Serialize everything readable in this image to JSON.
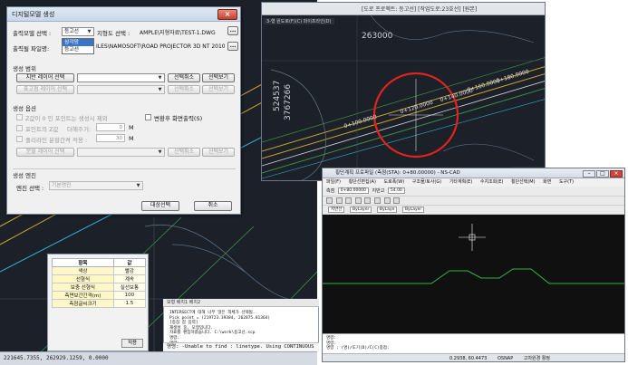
{
  "dialog": {
    "title": "디지털모델 생성",
    "close_label": "×",
    "output_model_label": "출력모델 선택 :",
    "output_model_value": "등고선",
    "output_model_options": [
      "삼각망",
      "등고선"
    ],
    "terrain_select_label": "지형도 선택 :",
    "terrain_path": "AMPLE\\지형자료\\TEST-1.DWG",
    "output_file_label": "출력될 파일명:",
    "output_file_path": "ILES\\NAMOSOFT\\ROAD PROJECTOR 3D NT 2010\\SAMP",
    "browse_label": "...",
    "section_range": "생성 범위",
    "terrain_layer_btn": "지반 레이어 선택",
    "range_cancel_btn": "선택취소",
    "range_view_btn": "선택보기",
    "elev_layer_btn": "표고점 레이어 선택",
    "elev_cancel_btn": "선택취소",
    "elev_view_btn": "선택보기",
    "section_options": "생성 옵션",
    "opt_zero_z": "Z값이 0 인 포인트는 생성시 제외",
    "opt_change_display": "변환후 화면출력(S)",
    "opt_point_z": "포인트의 Z값",
    "opt_increase": "더해주기:",
    "opt_increase_value": "0",
    "opt_increase_unit": "M",
    "opt_split": "폴리라인 분할간격 적용 :",
    "opt_split_value": "30",
    "opt_split_unit": "M",
    "split_layer_btn": "분할 레이어 선택",
    "split_cancel_btn": "선택취소",
    "split_view_btn": "선택보기",
    "section_engine": "생성 엔진",
    "engine_label": "엔진 선택 :",
    "engine_value": "기본엔진",
    "start_btn": "대상선택",
    "cancel_btn": "취소"
  },
  "top_cad": {
    "title": "[도로 프로젝트: 등고선]  [작업도로:23호선]  [원본]",
    "tab": "3-형 원도로(F)(C) 파이프라인(D)",
    "labels": [
      "263000",
      "524537",
      "3767266",
      "0+100.0000",
      "0+120.0000",
      "0+140.0000",
      "0+160.0000",
      "0+180.0000"
    ]
  },
  "profile_win": {
    "title": "횡단계획 프로파일 (측점(STA): 0+80.00000) - NS-CAD",
    "menu": [
      "파일(F)",
      "횡단선편집(A)",
      "도로폭(W)",
      "구조물/토사(G)",
      "기타계획(E)",
      "수치조회(E)",
      "횡단선택(M)",
      "화면",
      "도구(T)"
    ],
    "station_label": "측점",
    "station_value": "0+80.00000",
    "height_label": "지반고",
    "height_value": "54.00",
    "layer_value": "0",
    "bylayer1": "ByLayer",
    "bylayer2": "ByLayer",
    "linetype": "ByLaye",
    "ground_layer": "지반선",
    "cmd_lines": [
      "명령:",
      "명령:",
      "명령 : (명)/도기(D)/C(C)중점:"
    ],
    "coords": "0.2938, 60.4473",
    "osnap": "OSNAP",
    "status_text": "고차원경 활정"
  },
  "properties": {
    "headers": [
      "항목",
      "값"
    ],
    "rows": [
      [
        "색상",
        "빨강"
      ],
      [
        "선형식",
        "계속"
      ],
      [
        "보충 선형식",
        "실선보통"
      ],
      [
        "측면보간간격(m)",
        "100"
      ],
      [
        "측점글씨크기",
        "1.5"
      ]
    ],
    "apply_btn": "적용"
  },
  "command": {
    "tabs": "모형  배치1  배치2",
    "lines": [
      "INTERSECT에 대해 너무 많은 객체가 선택됨.",
      "Pick point = (219723.39384, 262875.81364)",
      "[종점 점 입력]",
      "재생성 중, 모형입니다.",
      "자료를 편집하였습니다. C:\\work\\등고선.scp",
      "명령:",
      "명령:"
    ],
    "input": "명령: -Unable to find : linetype. Using CONTINUOUS"
  },
  "status_left": "221645.7355, 262929.1259, 0.0000"
}
